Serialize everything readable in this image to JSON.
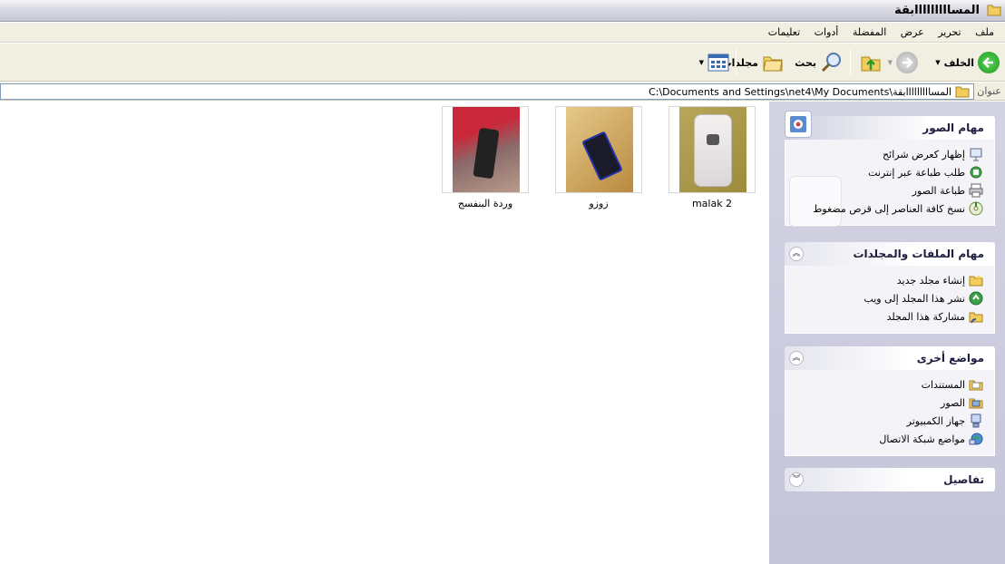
{
  "window": {
    "title": "المسااااااااابقة"
  },
  "menu": [
    "ملف",
    "تحرير",
    "عرض",
    "المفضلة",
    "أدوات",
    "تعليمات"
  ],
  "toolbar": {
    "back_label": "الخلف",
    "search_label": "بحث",
    "folders_label": "مجلدات"
  },
  "address": {
    "label": "عنوان",
    "path": "C:\\Documents and Settings\\net4\\My Documents\\المسااااااااابقة"
  },
  "panels": {
    "picture_tasks": {
      "title": "مهام الصور",
      "items": [
        "إظهار كعرض شرائح",
        "طلب طباعة عبر إنترنت",
        "طباعة الصور",
        "نسخ كافة العناصر إلى قرص مضغوط"
      ]
    },
    "file_tasks": {
      "title": "مهام الملفات والمجلدات",
      "items": [
        "إنشاء مجلد جديد",
        "نشر هذا المجلد إلى ويب",
        "مشاركة هذا المجلد"
      ]
    },
    "other_places": {
      "title": "مواضع أخرى",
      "items": [
        "المستندات",
        "الصور",
        "جهاز الكمبيوتر",
        "مواضع شبكة الاتصال"
      ]
    },
    "details": {
      "title": "تفاصيل"
    }
  },
  "files": [
    {
      "name": "malak 2"
    },
    {
      "name": "زوزو"
    },
    {
      "name": "وردة البنفسج"
    }
  ]
}
